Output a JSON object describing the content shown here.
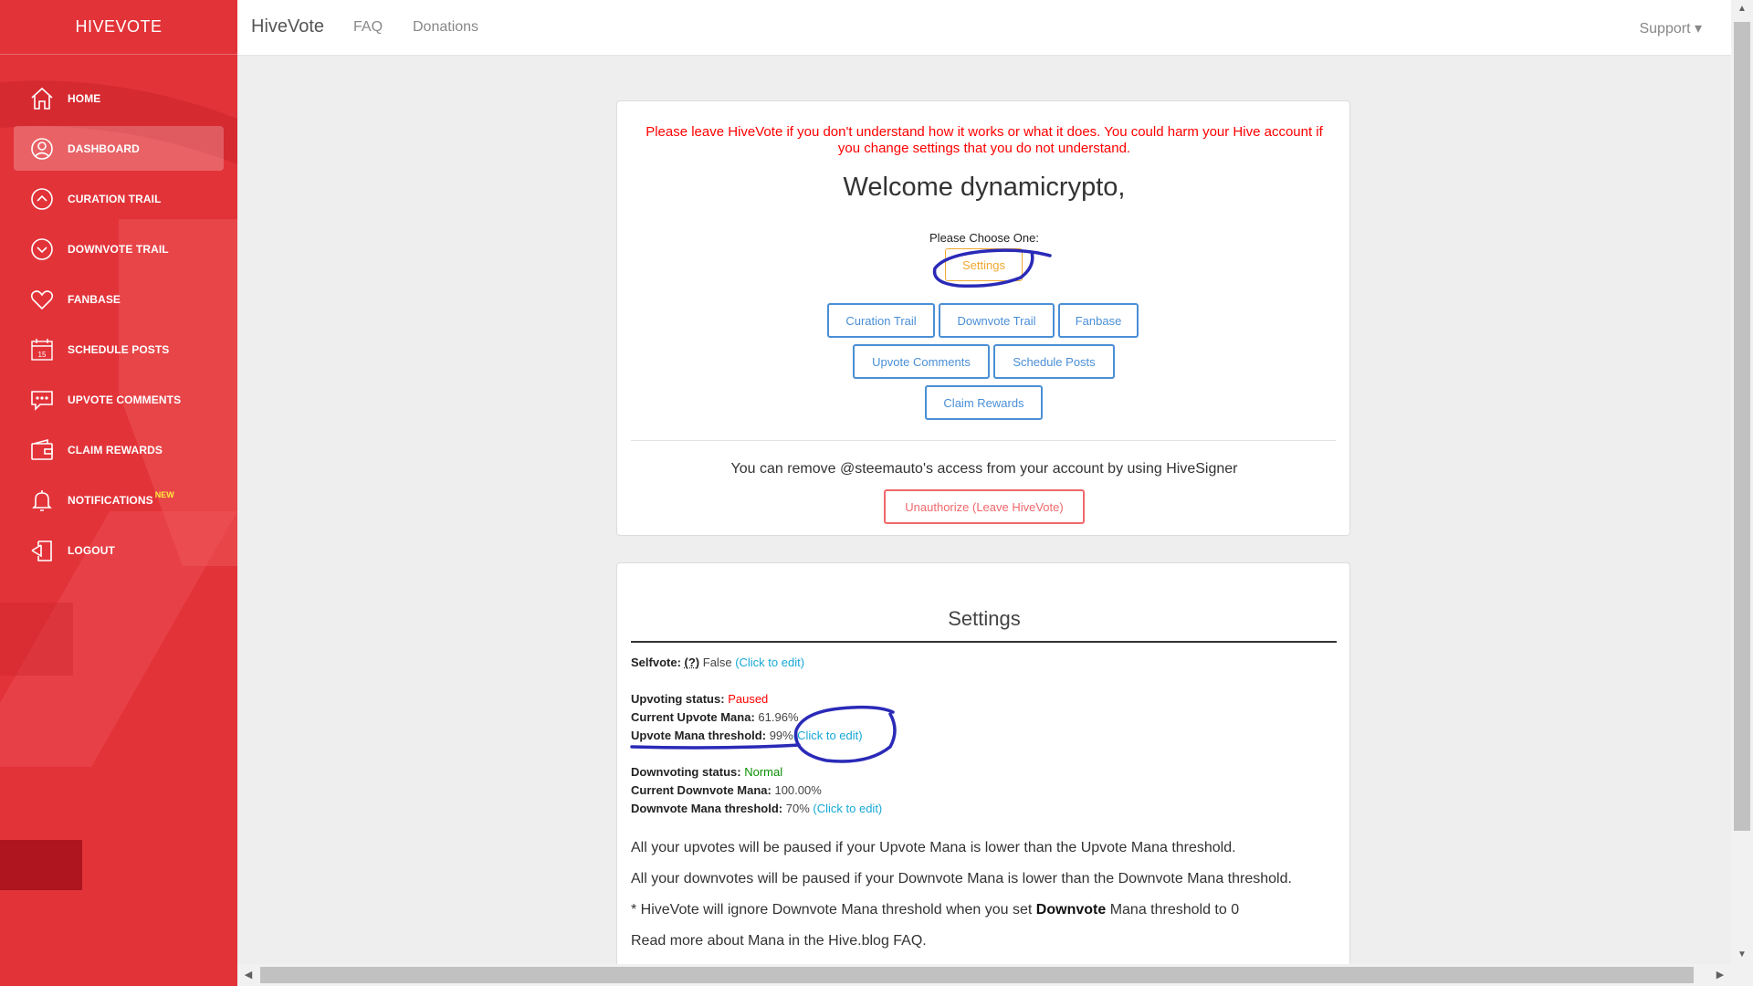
{
  "sidebar": {
    "brand": "HIVEVOTE",
    "items": [
      {
        "label": "Home",
        "icon": "home-icon"
      },
      {
        "label": "Dashboard",
        "icon": "user-icon"
      },
      {
        "label": "Curation Trail",
        "icon": "chevron-up-icon"
      },
      {
        "label": "Downvote Trail",
        "icon": "chevron-down-icon"
      },
      {
        "label": "Fanbase",
        "icon": "heart-icon"
      },
      {
        "label": "Schedule Posts",
        "icon": "calendar-icon"
      },
      {
        "label": "Upvote Comments",
        "icon": "comment-icon"
      },
      {
        "label": "Claim Rewards",
        "icon": "wallet-icon"
      },
      {
        "label": "Notifications",
        "icon": "bell-icon",
        "badge": "NEW"
      },
      {
        "label": "Logout",
        "icon": "logout-icon"
      }
    ],
    "calendar_day": "15"
  },
  "topbar": {
    "title": "HiveVote",
    "links": [
      "FAQ",
      "Donations"
    ],
    "support": "Support ▾"
  },
  "main": {
    "warning": "Please leave HiveVote if you don't understand how it works or what it does. You could harm your Hive account if you change settings that you do not understand.",
    "welcome": "Welcome dynamicrypto,",
    "choose": "Please Choose One:",
    "buttons": {
      "settings": "Settings",
      "curation_trail": "Curation Trail",
      "downvote_trail": "Downvote Trail",
      "fanbase": "Fanbase",
      "upvote_comments": "Upvote Comments",
      "schedule_posts": "Schedule Posts",
      "claim_rewards": "Claim Rewards"
    },
    "remove_text": "You can remove @steemauto's access from your account by using HiveSigner",
    "unauthorize": "Unauthorize (Leave HiveVote)"
  },
  "settings": {
    "title": "Settings",
    "selfvote": {
      "label": "Selfvote:",
      "help": "(?)",
      "value": "False",
      "edit": "(Click to edit)"
    },
    "upvoting_status": {
      "label": "Upvoting status:",
      "value": "Paused"
    },
    "current_upvote_mana": {
      "label": "Current Upvote Mana:",
      "value": "61.96%"
    },
    "upvote_threshold": {
      "label": "Upvote Mana threshold:",
      "value": "99%",
      "edit": "(Click to edit)"
    },
    "downvoting_status": {
      "label": "Downvoting status:",
      "value": "Normal"
    },
    "current_downvote_mana": {
      "label": "Current Downvote Mana:",
      "value": "100.00%"
    },
    "downvote_threshold": {
      "label": "Downvote Mana threshold:",
      "value": "70%",
      "edit": "(Click to edit)"
    },
    "notes": {
      "upvotes": "All your upvotes will be paused if your Upvote Mana is lower than the Upvote Mana threshold.",
      "downvotes": "All your downvotes will be paused if your Downvote Mana is lower than the Downvote Mana threshold.",
      "ignore_pre": "* HiveVote will ignore Downvote Mana threshold when you set ",
      "ignore_bold": "Downvote",
      "ignore_post": " Mana threshold to 0",
      "read_more": "Read more about Mana in the Hive.blog FAQ."
    }
  },
  "colors": {
    "sidebar": "#e23339",
    "primary_button": "#4a8fd6",
    "settings_button": "#f0a830",
    "danger": "#f0686c",
    "warning_text": "#ff0000",
    "edit_link": "#17a8d6",
    "annotation": "#2a2ab8"
  }
}
